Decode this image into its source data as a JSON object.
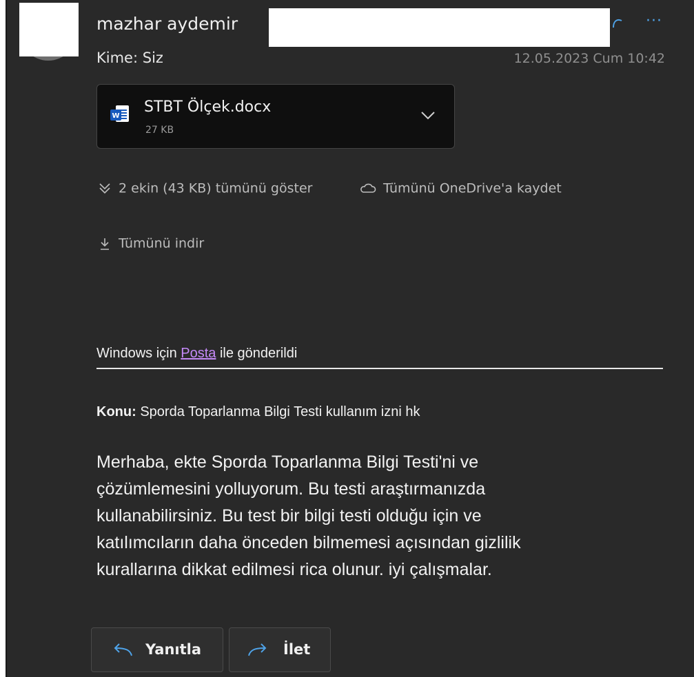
{
  "header": {
    "sender_name": "mazhar aydemir",
    "to_label": "Kime: Siz",
    "datetime": "12.05.2023 Cum 10:42",
    "more_icon": "more-icon",
    "reply_icon": "reply-icon"
  },
  "attachment": {
    "file_name": "STBT Ölçek.docx",
    "file_size": "27 KB",
    "file_icon": "word-icon",
    "chevron_icon": "chevron-down-icon"
  },
  "actions": {
    "show_all": "2 ekin (43 KB) tümünü göster",
    "save_onedrive": "Tümünü OneDrive'a kaydet",
    "download_all": "Tümünü indir"
  },
  "body": {
    "sent_prefix": "Windows için",
    "sent_link": "Posta",
    "sent_suffix": "ile gönderildi",
    "subject_label": "Konu:",
    "subject_text": "Sporda Toparlanma Bilgi Testi kullanım izni hk",
    "lines": [
      "Merhaba, ekte Sporda Toparlanma Bilgi Testi'ni ve",
      "çözümlemesini yolluyorum. Bu testi araştırmanızda",
      "kullanabilirsiniz. Bu test bir bilgi testi olduğu için ve",
      "katılımcıların daha önceden bilmemesi açısından gizlilik",
      "kurallarına dikkat edilmesi rica olunur. iyi çalışmalar."
    ]
  },
  "footer": {
    "reply_label": "Yanıtla",
    "forward_label": "İlet"
  },
  "colors": {
    "background": "#292929",
    "accent": "#4fa3e8",
    "link": "#c58af9",
    "word_blue": "#185abd"
  }
}
